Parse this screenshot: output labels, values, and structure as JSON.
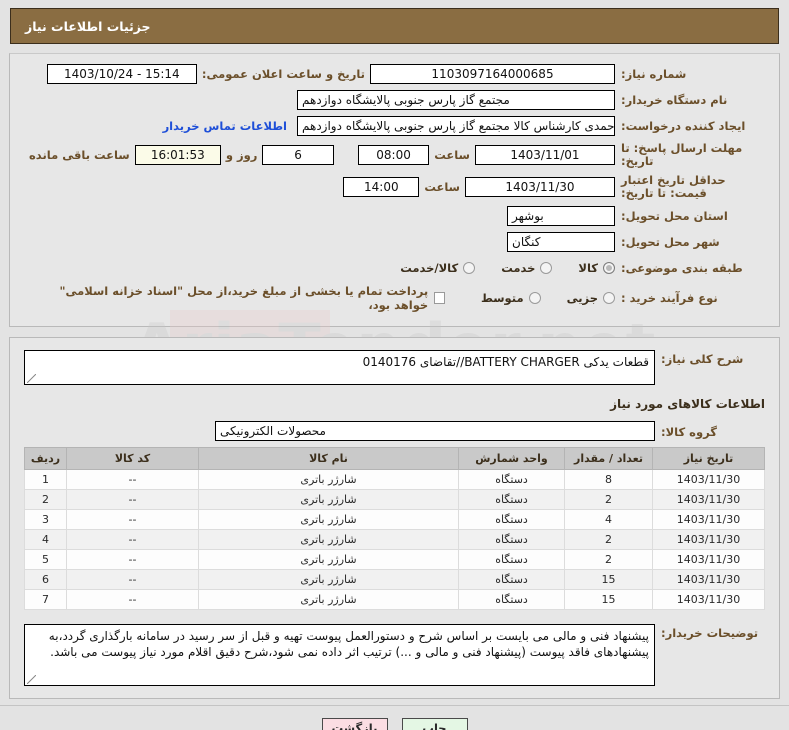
{
  "header": {
    "title": "جزئیات اطلاعات نیاز"
  },
  "form": {
    "need_number_label": "شماره نیاز:",
    "need_number_value": "1103097164000685",
    "announce_label": "تاریخ و ساعت اعلان عمومی:",
    "announce_value": "1403/10/24 - 15:14",
    "buyer_org_label": "نام دستگاه خریدار:",
    "buyer_org_value": "مجتمع گاز پارس جنوبی  پالایشگاه دوازدهم",
    "creator_label": "ایجاد کننده درخواست:",
    "creator_value": "عبدالهادی احمدی کارشناس کالا مجتمع گاز پارس جنوبی  پالایشگاه دوازدهم",
    "contact_link": "اطلاعات تماس خریدار",
    "deadline_label": "مهلت ارسال پاسخ: تا تاریخ:",
    "deadline_date": "1403/11/01",
    "hour_label": "ساعت",
    "deadline_time": "08:00",
    "remaining_days": "6",
    "remaining_days_sep": "روز و",
    "remaining_clock": "16:01:53",
    "remaining_suffix": "ساعت باقی مانده",
    "price_valid_label": "حداقل تاریخ اعتبار قیمت: تا تاریخ:",
    "price_valid_date": "1403/11/30",
    "price_valid_time": "14:00",
    "province_label": "استان محل تحویل:",
    "province_value": "بوشهر",
    "city_label": "شهر محل تحویل:",
    "city_value": "کنگان",
    "category_label": "طبقه بندی موضوعی:",
    "category_options": [
      "کالا",
      "خدمت",
      "کالا/خدمت"
    ],
    "category_selected": "کالا",
    "process_label": "نوع فرآیند خرید :",
    "process_options": [
      "جزیی",
      "متوسط"
    ],
    "process_selected": "",
    "treasury_checkbox_label": "پرداخت تمام یا بخشی از مبلغ خرید،از محل \"اسناد خزانه اسلامی\" خواهد بود،",
    "treasury_checked": false
  },
  "summary": {
    "label": "شرح کلی نیاز:",
    "value": "قطعات یدکی BATTERY CHARGER//تقاضای 0140176"
  },
  "goods": {
    "section_title": "اطلاعات کالاهای مورد نیاز",
    "group_label": "گروه کالا:",
    "group_value": "محصولات الکترونیکی",
    "columns": [
      "ردیف",
      "کد کالا",
      "نام کالا",
      "واحد شمارش",
      "تعداد / مقدار",
      "تاریخ نیاز"
    ],
    "rows": [
      {
        "row": "1",
        "code": "--",
        "name": "شارژر باتری",
        "unit": "دستگاه",
        "qty": "8",
        "date": "1403/11/30"
      },
      {
        "row": "2",
        "code": "--",
        "name": "شارژر باتری",
        "unit": "دستگاه",
        "qty": "2",
        "date": "1403/11/30"
      },
      {
        "row": "3",
        "code": "--",
        "name": "شارژر باتری",
        "unit": "دستگاه",
        "qty": "4",
        "date": "1403/11/30"
      },
      {
        "row": "4",
        "code": "--",
        "name": "شارژر باتری",
        "unit": "دستگاه",
        "qty": "2",
        "date": "1403/11/30"
      },
      {
        "row": "5",
        "code": "--",
        "name": "شارژر باتری",
        "unit": "دستگاه",
        "qty": "2",
        "date": "1403/11/30"
      },
      {
        "row": "6",
        "code": "--",
        "name": "شارژر باتری",
        "unit": "دستگاه",
        "qty": "15",
        "date": "1403/11/30"
      },
      {
        "row": "7",
        "code": "--",
        "name": "شارژر باتری",
        "unit": "دستگاه",
        "qty": "15",
        "date": "1403/11/30"
      }
    ]
  },
  "buyer_notes": {
    "label": "توضیحات خریدار:",
    "value": "پیشنهاد فنی و مالی می بایست بر اساس شرح و دستورالعمل پیوست تهیه و قبل از سر رسید در سامانه بارگذاری گردد،به پیشنهادهای فاقد پیوست (پیشنهاد فنی و مالی و ...) ترتیب اثر داده نمی شود،شرح دقیق اقلام مورد نیاز پیوست می باشد."
  },
  "footer": {
    "print_label": "چاپ",
    "back_label": "بازگشت"
  },
  "watermark": {
    "text": "AriaTender.net"
  },
  "colors": {
    "header_brown": "#8a6d42",
    "label_brown": "#6b4f2a",
    "link_blue": "#1e4fd8",
    "print_green": "#e4f7e4",
    "back_pink": "#fbdde3"
  }
}
